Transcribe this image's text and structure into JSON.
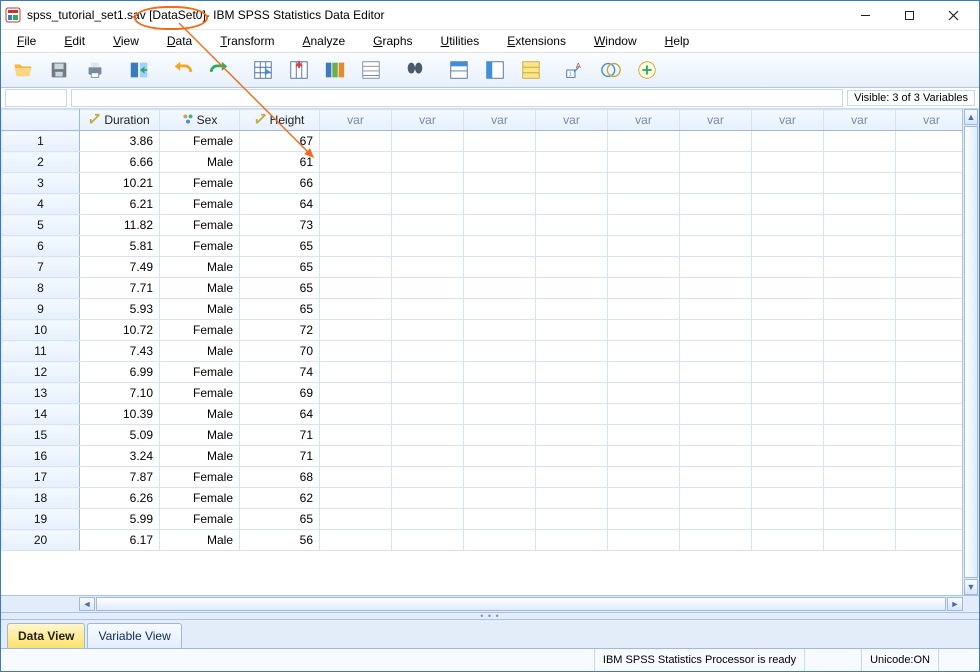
{
  "title": {
    "filename": "spss_tutorial_set1.sav",
    "dataset": "[DataSet0]",
    "suffix": " - IBM SPSS Statistics Data Editor"
  },
  "menus": [
    {
      "key": "F",
      "rest": "ile"
    },
    {
      "key": "E",
      "rest": "dit"
    },
    {
      "key": "V",
      "rest": "iew"
    },
    {
      "key": "D",
      "rest": "ata"
    },
    {
      "key": "T",
      "rest": "ransform"
    },
    {
      "key": "A",
      "rest": "nalyze"
    },
    {
      "key": "G",
      "rest": "raphs"
    },
    {
      "key": "U",
      "rest": "tilities"
    },
    {
      "key": "E",
      "rest": "xtensions"
    },
    {
      "key": "W",
      "rest": "indow"
    },
    {
      "key": "H",
      "rest": "elp"
    }
  ],
  "visible_text": "Visible: 3 of 3 Variables",
  "columns": [
    {
      "label": "Duration",
      "type": "scale"
    },
    {
      "label": "Sex",
      "type": "nominal"
    },
    {
      "label": "Height",
      "type": "scale"
    }
  ],
  "empty_col_label": "var",
  "rows": [
    {
      "n": 1,
      "Duration": "3.86",
      "Sex": "Female",
      "Height": "67"
    },
    {
      "n": 2,
      "Duration": "6.66",
      "Sex": "Male",
      "Height": "61"
    },
    {
      "n": 3,
      "Duration": "10.21",
      "Sex": "Female",
      "Height": "66"
    },
    {
      "n": 4,
      "Duration": "6.21",
      "Sex": "Female",
      "Height": "64"
    },
    {
      "n": 5,
      "Duration": "11.82",
      "Sex": "Female",
      "Height": "73"
    },
    {
      "n": 6,
      "Duration": "5.81",
      "Sex": "Female",
      "Height": "65"
    },
    {
      "n": 7,
      "Duration": "7.49",
      "Sex": "Male",
      "Height": "65"
    },
    {
      "n": 8,
      "Duration": "7.71",
      "Sex": "Male",
      "Height": "65"
    },
    {
      "n": 9,
      "Duration": "5.93",
      "Sex": "Male",
      "Height": "65"
    },
    {
      "n": 10,
      "Duration": "10.72",
      "Sex": "Female",
      "Height": "72"
    },
    {
      "n": 11,
      "Duration": "7.43",
      "Sex": "Male",
      "Height": "70"
    },
    {
      "n": 12,
      "Duration": "6.99",
      "Sex": "Female",
      "Height": "74"
    },
    {
      "n": 13,
      "Duration": "7.10",
      "Sex": "Female",
      "Height": "69"
    },
    {
      "n": 14,
      "Duration": "10.39",
      "Sex": "Male",
      "Height": "64"
    },
    {
      "n": 15,
      "Duration": "5.09",
      "Sex": "Male",
      "Height": "71"
    },
    {
      "n": 16,
      "Duration": "3.24",
      "Sex": "Male",
      "Height": "71"
    },
    {
      "n": 17,
      "Duration": "7.87",
      "Sex": "Female",
      "Height": "68"
    },
    {
      "n": 18,
      "Duration": "6.26",
      "Sex": "Female",
      "Height": "62"
    },
    {
      "n": 19,
      "Duration": "5.99",
      "Sex": "Female",
      "Height": "65"
    },
    {
      "n": 20,
      "Duration": "6.17",
      "Sex": "Male",
      "Height": "56"
    }
  ],
  "tabs": {
    "data": "Data View",
    "variable": "Variable View"
  },
  "status": {
    "processor": "IBM SPSS Statistics Processor is ready",
    "unicode": "Unicode:ON"
  }
}
